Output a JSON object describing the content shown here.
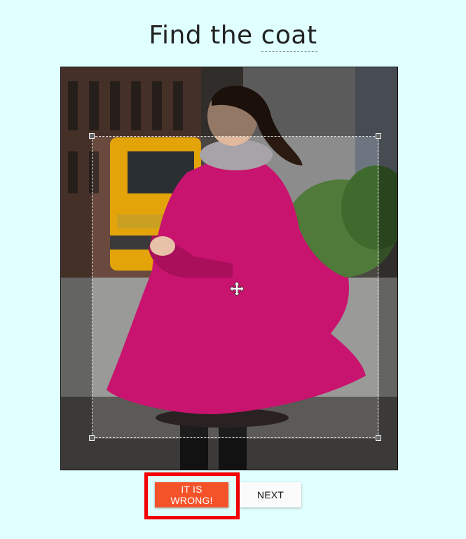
{
  "title": {
    "prefix": "Find the",
    "target": "coat"
  },
  "buttons": {
    "wrong_label": "IT IS WRONG!",
    "next_label": "NEXT"
  },
  "colors": {
    "background": "#e0ffff",
    "wrong_button": "#f4532a",
    "highlight_frame": "#f40000",
    "coat": "#c8146e"
  },
  "icons": {
    "crop_center": "move-icon"
  }
}
